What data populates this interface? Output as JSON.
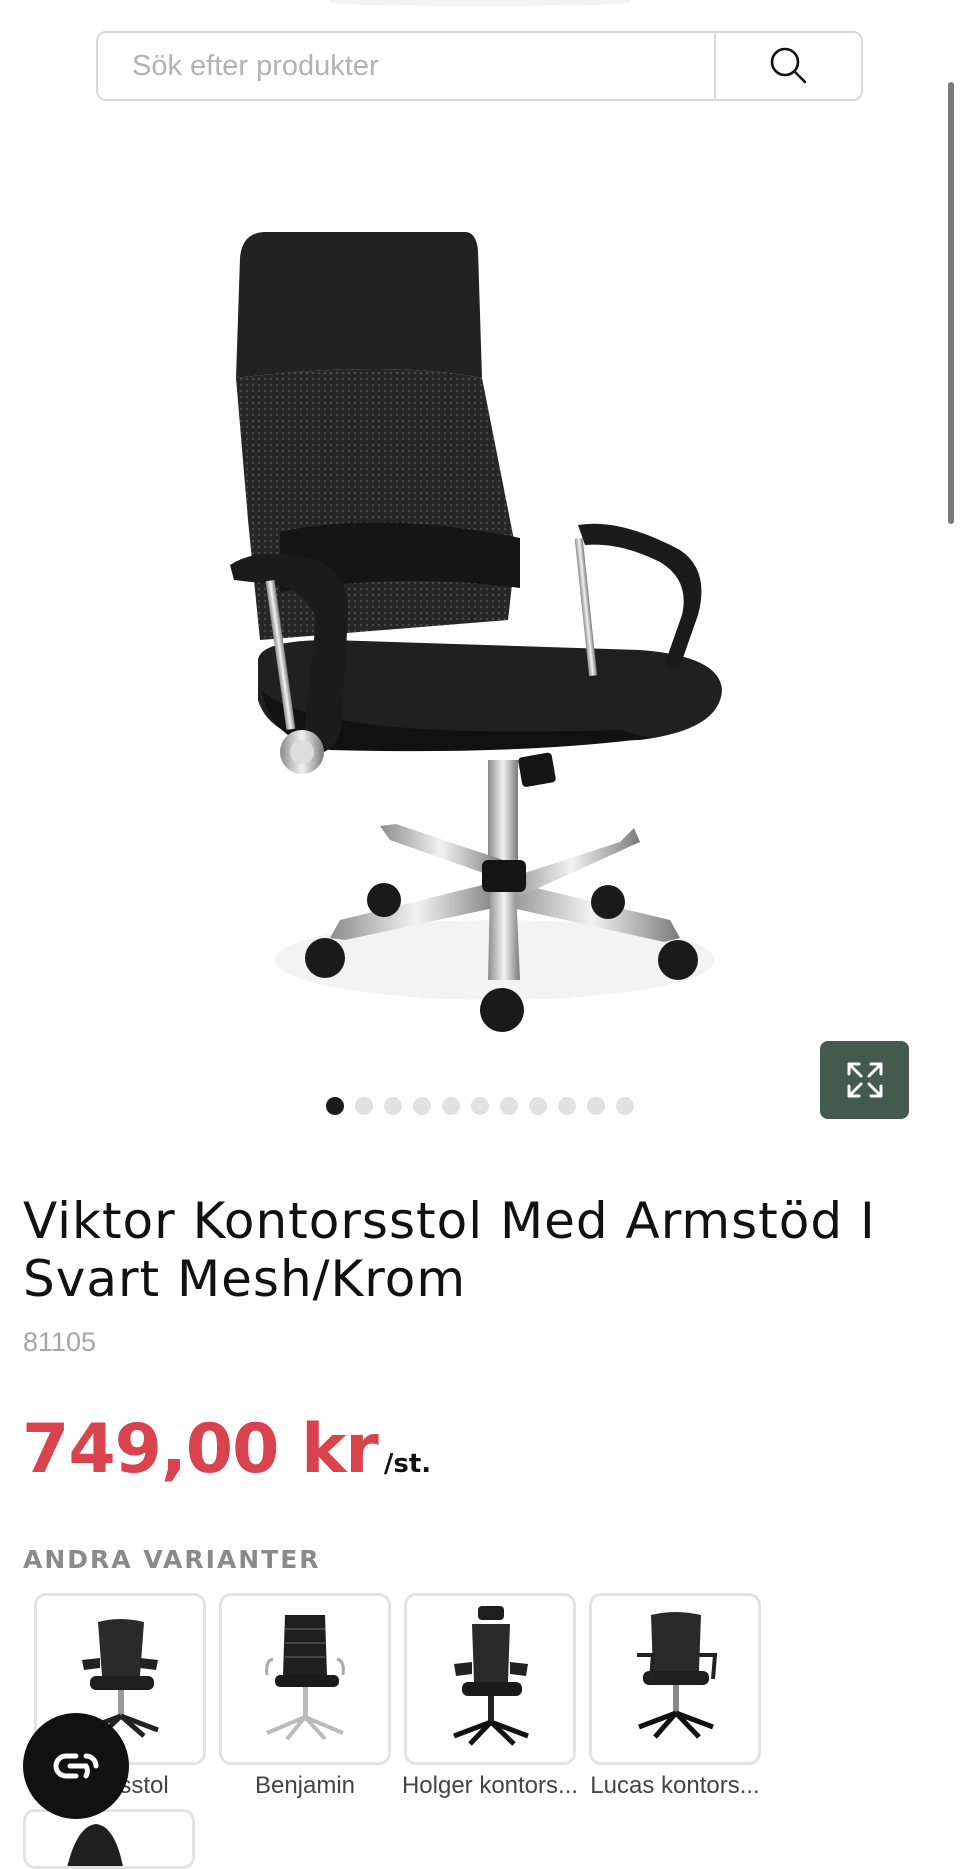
{
  "search": {
    "placeholder": "Sök efter produkter"
  },
  "gallery": {
    "image_count": 11,
    "active_index": 0
  },
  "product": {
    "title": "Viktor Kontorsstol Med Armstöd I Svart Mesh/Krom",
    "sku": "81105",
    "price": "749,00 kr",
    "price_unit": "/st.",
    "price_color": "#d9434d"
  },
  "variants": {
    "heading": "ANDRA VARIANTER",
    "items": [
      {
        "label": "...torsstol"
      },
      {
        "label": "Benjamin"
      },
      {
        "label": "Holger kontors..."
      },
      {
        "label": "Lucas kontors..."
      }
    ]
  },
  "colors": {
    "accent": "#445a4c",
    "text": "#111111"
  }
}
